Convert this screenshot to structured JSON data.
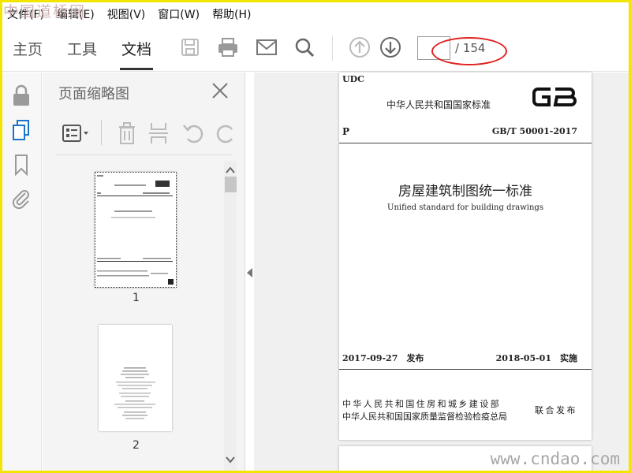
{
  "watermarks": {
    "top_left": "中国道桥网",
    "bottom_right": "www.cndao.com"
  },
  "menu": [
    {
      "label": "文件(F)"
    },
    {
      "label": "编辑(E)"
    },
    {
      "label": "视图(V)"
    },
    {
      "label": "窗口(W)"
    },
    {
      "label": "帮助(H)"
    }
  ],
  "toolbar": {
    "tabs": [
      {
        "label": "主页",
        "active": false
      },
      {
        "label": "工具",
        "active": false
      },
      {
        "label": "文档",
        "active": true
      }
    ],
    "icons": [
      "save-icon",
      "print-icon",
      "mail-icon",
      "search-icon",
      "page-up-icon",
      "page-down-icon"
    ],
    "page_input_value": "",
    "page_total": "/ 154"
  },
  "rail": {
    "icons": [
      "lock-icon",
      "page-thumbnails-icon",
      "bookmark-icon",
      "attachment-icon"
    ]
  },
  "panel": {
    "title": "页面缩略图",
    "thumbnails": [
      {
        "label": "1",
        "selected": true
      },
      {
        "label": "2",
        "selected": false
      }
    ]
  },
  "document_page": {
    "udc": "UDC",
    "national_standard": "中华人民共和国国家标准",
    "p": "P",
    "code": "GB/T 50001-2017",
    "title_cn": "房屋建筑制图统一标准",
    "title_en": "Unified standard for building drawings",
    "date_published": "2017-09-27　发布",
    "date_effective": "2018-05-01　实施",
    "issuer_1": "中华人民共和国住房和城乡建设部",
    "issuer_2": "中华人民共和国国家质量监督检验检疫总局",
    "jointly": "联合发布"
  },
  "colors": {
    "frame": "#f2e600",
    "highlight_oval": "#e02020",
    "accent_blue": "#1a73c8"
  }
}
